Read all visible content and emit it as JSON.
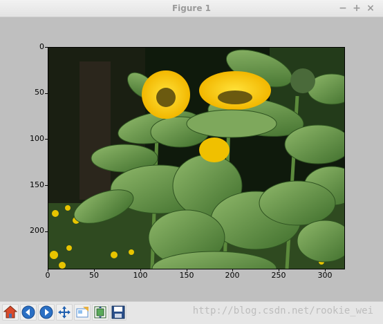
{
  "window": {
    "title": "Figure 1",
    "minimize_label": "−",
    "maximize_label": "+",
    "close_label": "×"
  },
  "chart_data": {
    "type": "image",
    "image_description": "photo of yellow sunflowers with large green leaves",
    "xlim": [
      0,
      320
    ],
    "ylim": [
      240,
      0
    ],
    "x_ticks": [
      "0",
      "50",
      "100",
      "150",
      "200",
      "250",
      "300"
    ],
    "y_ticks": [
      "0",
      "50",
      "100",
      "150",
      "200"
    ]
  },
  "toolbar": {
    "buttons": [
      {
        "name": "home",
        "icon": "home-icon"
      },
      {
        "name": "back",
        "icon": "back-arrow-icon"
      },
      {
        "name": "forward",
        "icon": "forward-arrow-icon"
      },
      {
        "name": "pan",
        "icon": "pan-arrows-icon"
      },
      {
        "name": "zoom",
        "icon": "zoom-rect-icon"
      },
      {
        "name": "configure-subplots",
        "icon": "subplots-icon"
      },
      {
        "name": "save",
        "icon": "save-floppy-icon"
      }
    ]
  },
  "watermark": "http://blog.csdn.net/rookie_wei"
}
